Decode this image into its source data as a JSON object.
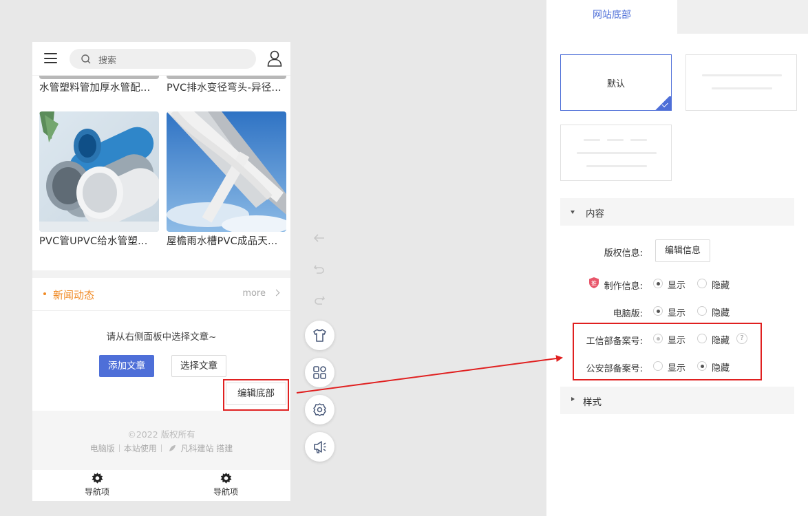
{
  "search": {
    "placeholder": "搜索"
  },
  "products": [
    {
      "title": "水管塑料管加厚水管配..."
    },
    {
      "title": "PVC排水变径弯头-异径..."
    },
    {
      "title": "PVC管UPVC给水管塑..."
    },
    {
      "title": "屋檐雨水槽PVC成品天..."
    }
  ],
  "news": {
    "title": "新闻动态",
    "more": "more",
    "hint": "请从右侧面板中选择文章~",
    "add_button": "添加文章",
    "select_button": "选择文章"
  },
  "edit_footer_button": "编辑底部",
  "footer": {
    "copyright": "©2022 版权所有",
    "links": [
      "电脑版",
      "本站使用",
      "凡科建站 搭建"
    ]
  },
  "tabbar": [
    {
      "label": "导航项"
    },
    {
      "label": "导航项"
    }
  ],
  "panel": {
    "tab": "网站底部",
    "style_default_label": "默认",
    "content_section": "内容",
    "style_section": "样式",
    "rows": {
      "copyright_label": "版权信息:",
      "copyright_button": "编辑信息",
      "producer_label": "制作信息:",
      "pc_label": "电脑版:",
      "miit_label": "工信部备案号:",
      "police_label": "公安部备案号:",
      "show": "显示",
      "hide": "隐藏",
      "help": "?"
    }
  },
  "colors": {
    "accent": "#4e6fd8",
    "news_orange": "#f08a24",
    "highlight_red": "#e02020"
  }
}
